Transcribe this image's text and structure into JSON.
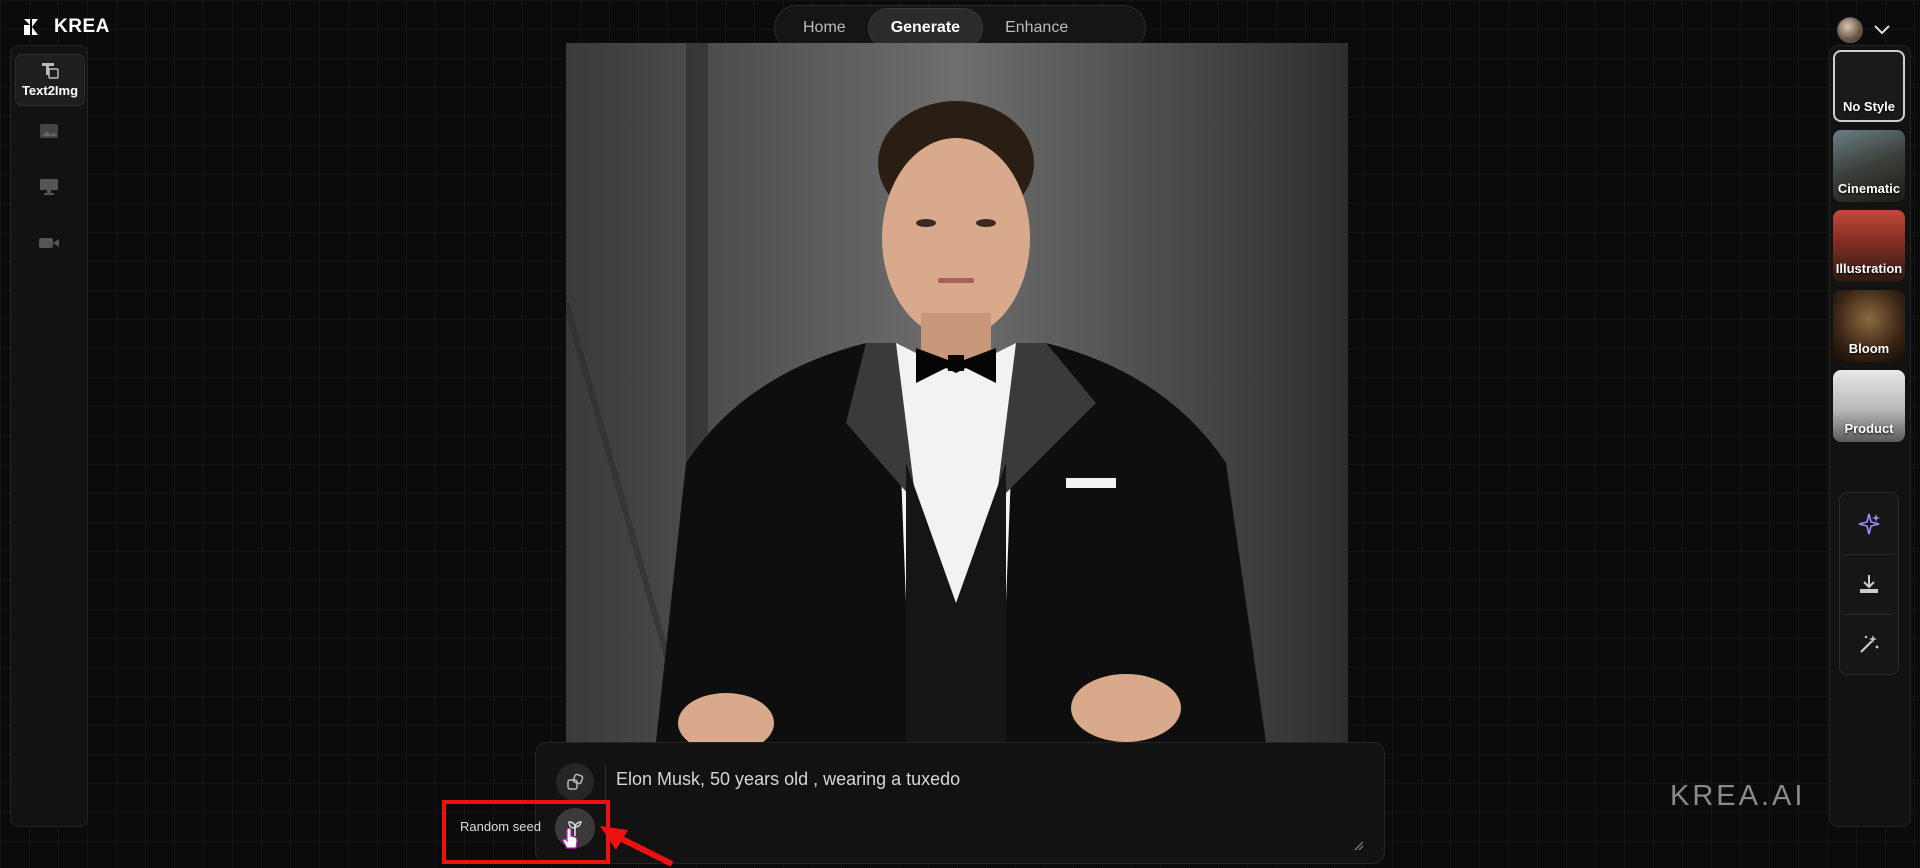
{
  "app": {
    "name": "KREA"
  },
  "nav": {
    "tabs": [
      {
        "label": "Home"
      },
      {
        "label": "Generate"
      },
      {
        "label": "Enhance"
      }
    ],
    "active": "Generate"
  },
  "left_rail": {
    "items": [
      {
        "label": "Text2Img",
        "icon": "text-to-image-icon",
        "active": true
      },
      {
        "label": "",
        "icon": "image-icon"
      },
      {
        "label": "",
        "icon": "screen-icon"
      },
      {
        "label": "",
        "icon": "video-icon"
      }
    ]
  },
  "styles": [
    {
      "label": "No Style",
      "active": true
    },
    {
      "label": "Cinematic"
    },
    {
      "label": "Illustration"
    },
    {
      "label": "Bloom"
    },
    {
      "label": "Product"
    }
  ],
  "tools": [
    "enhance-sparkle-icon",
    "download-icon",
    "magic-wand-icon"
  ],
  "prompt": {
    "text": "Elon Musk, 50 years old , wearing a tuxedo"
  },
  "seed": {
    "label": "Random seed"
  },
  "watermark": "KREA.AI",
  "colors": {
    "highlight": "#ee1111",
    "background": "#0b0b0b"
  }
}
